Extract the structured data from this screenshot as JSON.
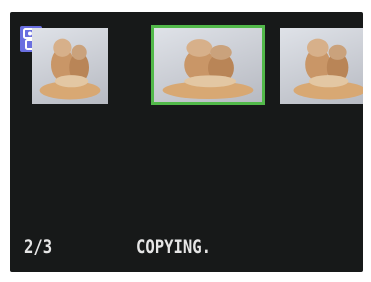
{
  "screen": {
    "mode_icon": "playback-mode-icon",
    "thumbnails": [
      {
        "name": "photo-thumbnail-previous",
        "selected": false
      },
      {
        "name": "photo-thumbnail-current",
        "selected": true
      },
      {
        "name": "photo-thumbnail-next",
        "selected": false
      }
    ],
    "counter": "2/3",
    "status": "COPYING.",
    "colors": {
      "background": "#171919",
      "selection_border": "#52b94a",
      "text": "#e6e6e6",
      "icon": "#6a6fe0"
    }
  }
}
